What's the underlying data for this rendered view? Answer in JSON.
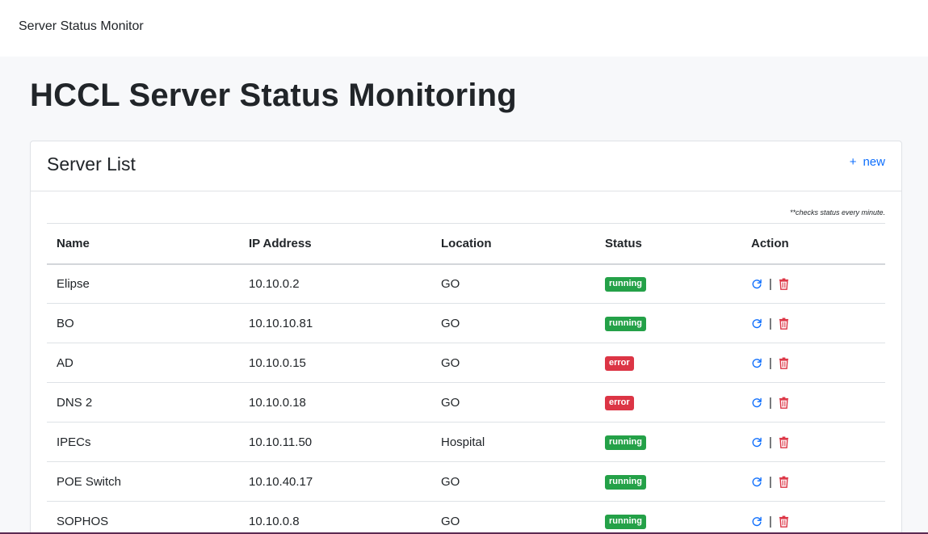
{
  "navbar": {
    "brand": "Server Status Monitor"
  },
  "page": {
    "title": "HCCL Server Status Monitoring"
  },
  "card": {
    "title": "Server List",
    "new_plus": "+",
    "new_label": "new",
    "note": "**checks status every minute."
  },
  "table": {
    "headers": [
      "Name",
      "IP Address",
      "Location",
      "Status",
      "Action"
    ],
    "rows": [
      {
        "name": "Elipse",
        "ip": "10.10.0.2",
        "location": "GO",
        "status": "running"
      },
      {
        "name": "BO",
        "ip": "10.10.10.81",
        "location": "GO",
        "status": "running"
      },
      {
        "name": "AD",
        "ip": "10.10.0.15",
        "location": "GO",
        "status": "error"
      },
      {
        "name": "DNS 2",
        "ip": "10.10.0.18",
        "location": "GO",
        "status": "error"
      },
      {
        "name": "IPECs",
        "ip": "10.10.11.50",
        "location": "Hospital",
        "status": "running"
      },
      {
        "name": "POE Switch",
        "ip": "10.10.40.17",
        "location": "GO",
        "status": "running"
      },
      {
        "name": "SOPHOS",
        "ip": "10.10.0.8",
        "location": "GO",
        "status": "running"
      }
    ],
    "action_separator": "|",
    "icons": {
      "refresh": "refresh-icon",
      "delete": "trash-icon"
    }
  },
  "colors": {
    "accent": "#0d6efd",
    "running": "#24a148",
    "error": "#dc3545"
  }
}
